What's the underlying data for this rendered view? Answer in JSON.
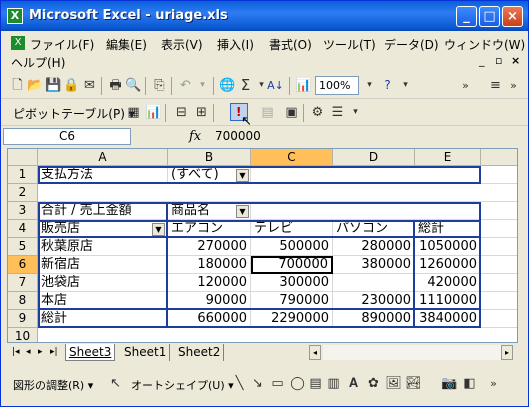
{
  "window": {
    "title": "Microsoft Excel - uriage.xls",
    "app_icon": "X"
  },
  "menu": {
    "items": [
      "ファイル(F)",
      "編集(E)",
      "表示(V)",
      "挿入(I)",
      "書式(O)",
      "ツール(T)",
      "データ(D)",
      "ウィンドウ(W)"
    ],
    "help": "ヘルプ(H)"
  },
  "toolbar1": {
    "zoom": "100%"
  },
  "toolbar2": {
    "pivot_label": "ピボットテーブル(P) ▾"
  },
  "formula_bar": {
    "name_box": "C6",
    "fx": "fx",
    "value": "700000"
  },
  "columns": [
    "A",
    "B",
    "C",
    "D",
    "E"
  ],
  "rows": [
    "1",
    "2",
    "3",
    "4",
    "5",
    "6",
    "7",
    "8",
    "9",
    "10"
  ],
  "sheet": {
    "r1": {
      "a": "支払方法",
      "b": "(すべて)"
    },
    "r3": {
      "a": "合計 / 売上金額",
      "b": "商品名"
    },
    "r4": {
      "a": "販売店",
      "b": "エアコン",
      "c": "テレビ",
      "d": "パソコン",
      "e": "総計"
    },
    "r5": {
      "a": "秋葉原店",
      "b": "270000",
      "c": "500000",
      "d": "280000",
      "e": "1050000"
    },
    "r6": {
      "a": "新宿店",
      "b": "180000",
      "c": "700000",
      "d": "380000",
      "e": "1260000"
    },
    "r7": {
      "a": "池袋店",
      "b": "120000",
      "c": "300000",
      "d": "",
      "e": "420000"
    },
    "r8": {
      "a": "本店",
      "b": "90000",
      "c": "790000",
      "d": "230000",
      "e": "1110000"
    },
    "r9": {
      "a": "総計",
      "b": "660000",
      "c": "2290000",
      "d": "890000",
      "e": "3840000"
    }
  },
  "tabs": [
    "Sheet3",
    "Sheet1",
    "Sheet2"
  ],
  "drawing": {
    "adjust": "図形の調整(R) ▾",
    "autoshape": "オートシェイプ(U) ▾"
  }
}
